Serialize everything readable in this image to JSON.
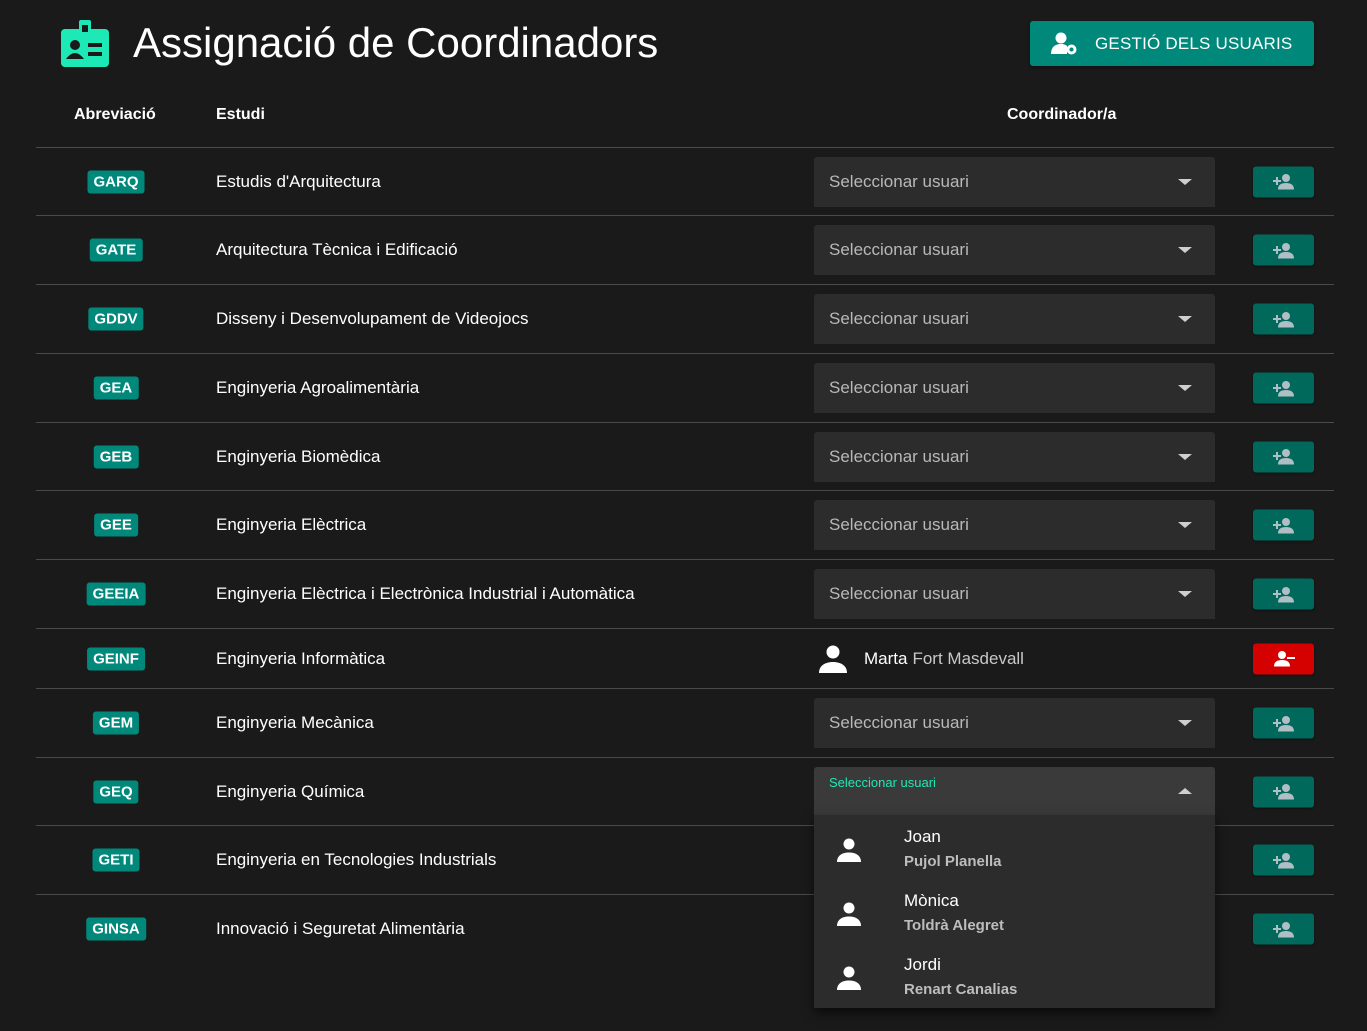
{
  "header": {
    "title": "Assignació de Coordinadors",
    "title_icon": "badge-icon",
    "manage_button": {
      "label": "GESTIÓ DELS USUARIS",
      "icon": "user-gear-icon"
    }
  },
  "table": {
    "columns": {
      "abbr": "Abreviació",
      "study": "Estudi",
      "coordinator": "Coordinador/a"
    },
    "select_placeholder": "Seleccionar usuari",
    "rows": [
      {
        "abbr": "GARQ",
        "study": "Estudis d'Arquitectura",
        "state": "select"
      },
      {
        "abbr": "GATE",
        "study": "Arquitectura Tècnica i Edificació",
        "state": "select"
      },
      {
        "abbr": "GDDV",
        "study": "Disseny i Desenvolupament de Videojocs",
        "state": "select"
      },
      {
        "abbr": "GEA",
        "study": "Enginyeria Agroalimentària",
        "state": "select"
      },
      {
        "abbr": "GEB",
        "study": "Enginyeria Biomèdica",
        "state": "select"
      },
      {
        "abbr": "GEE",
        "study": "Enginyeria Elèctrica",
        "state": "select"
      },
      {
        "abbr": "GEEIA",
        "study": "Enginyeria Elèctrica i Electrònica Industrial i Automàtica",
        "state": "select"
      },
      {
        "abbr": "GEINF",
        "study": "Enginyeria Informàtica",
        "state": "assigned",
        "coordinator": {
          "first": "Marta",
          "last": "Fort Masdevall"
        }
      },
      {
        "abbr": "GEM",
        "study": "Enginyeria Mecànica",
        "state": "select"
      },
      {
        "abbr": "GEQ",
        "study": "Enginyeria Química",
        "state": "open"
      },
      {
        "abbr": "GETI",
        "study": "Enginyeria en Tecnologies Industrials",
        "state": "select"
      },
      {
        "abbr": "GINSA",
        "study": "Innovació i Seguretat Alimentària",
        "state": "select"
      }
    ]
  },
  "dropdown": {
    "options": [
      {
        "first": "Joan",
        "last": "Pujol Planella"
      },
      {
        "first": "Mònica",
        "last": "Toldrà Alegret"
      },
      {
        "first": "Jordi",
        "last": "Renart Canalias"
      }
    ]
  },
  "colors": {
    "background": "#1a1a1a",
    "accent": "#00897b",
    "accent_dark": "#00695c",
    "focus": "#1de9b6",
    "danger": "#d50000"
  }
}
